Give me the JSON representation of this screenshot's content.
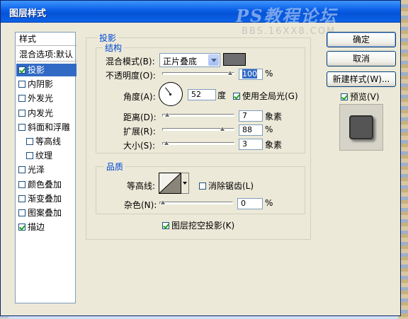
{
  "window": {
    "title": "图层样式"
  },
  "watermark": {
    "text": "PS教程论坛",
    "sub": "BBS.16XX8.COM"
  },
  "styles_list": {
    "header": "样式",
    "blend_options": "混合选项:默认",
    "items": [
      {
        "label": "投影",
        "checked": true,
        "selected": true
      },
      {
        "label": "内阴影",
        "checked": false
      },
      {
        "label": "外发光",
        "checked": false
      },
      {
        "label": "内发光",
        "checked": false
      },
      {
        "label": "斜面和浮雕",
        "checked": false
      },
      {
        "label": "等高线",
        "checked": false,
        "sub": true
      },
      {
        "label": "纹理",
        "checked": false,
        "sub": true
      },
      {
        "label": "光泽",
        "checked": false
      },
      {
        "label": "颜色叠加",
        "checked": false
      },
      {
        "label": "渐变叠加",
        "checked": false
      },
      {
        "label": "图案叠加",
        "checked": false
      },
      {
        "label": "描边",
        "checked": true
      }
    ]
  },
  "drop_shadow": {
    "title": "投影",
    "structure": {
      "title": "结构",
      "blend_mode_label": "混合模式(B):",
      "blend_mode_value": "正片叠底",
      "shadow_color": "#6e6e70",
      "opacity_label": "不透明度(O):",
      "opacity_value": "100",
      "opacity_unit": "%",
      "opacity_percent": 100,
      "angle_label": "角度(A):",
      "angle_value": "52",
      "angle_unit": "度",
      "global_light_label": "使用全局光(G)",
      "global_light_checked": true,
      "distance_label": "距离(D):",
      "distance_value": "7",
      "distance_unit": "象素",
      "distance_percent": 2,
      "spread_label": "扩展(R):",
      "spread_value": "88",
      "spread_unit": "%",
      "spread_percent": 88,
      "size_label": "大小(S):",
      "size_value": "3",
      "size_unit": "象素",
      "size_percent": 1
    },
    "quality": {
      "title": "品质",
      "contour_label": "等高线:",
      "antialias_label": "消除锯齿(L)",
      "antialias_checked": false,
      "noise_label": "杂色(N):",
      "noise_value": "0",
      "noise_unit": "%",
      "noise_percent": 0
    },
    "knockout_label": "图层挖空投影(K)",
    "knockout_checked": true
  },
  "buttons": {
    "ok": "确定",
    "cancel": "取消",
    "new_style": "新建样式(W)...",
    "preview_label": "预览(V)",
    "preview_checked": true
  }
}
